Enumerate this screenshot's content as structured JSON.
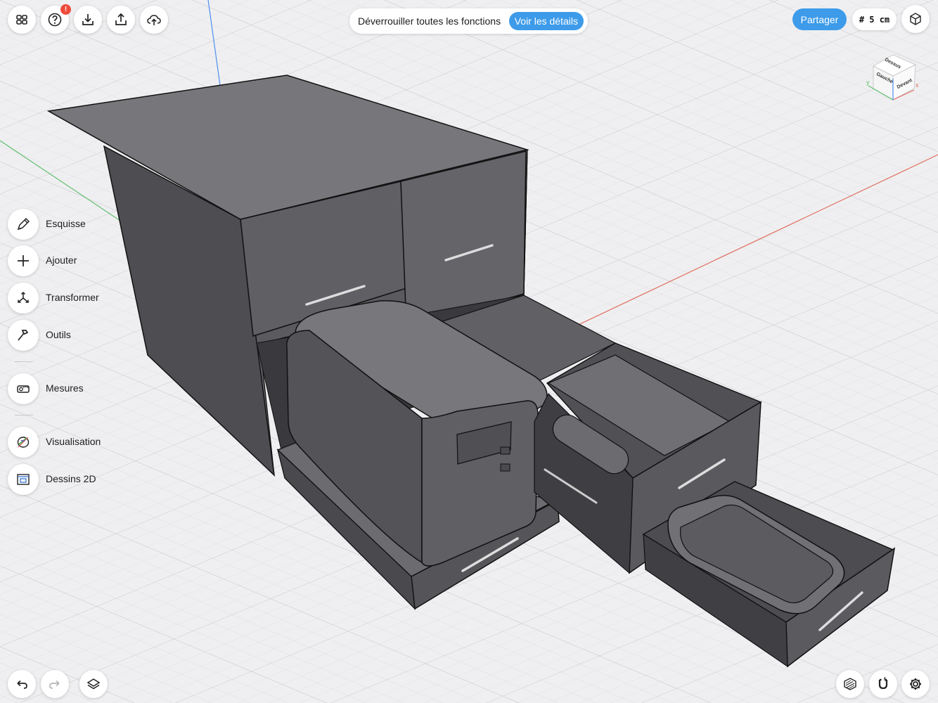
{
  "app": {
    "banner": {
      "text": "Déverrouiller toutes les fonctions",
      "button": "Voir les détails"
    },
    "badge": "!",
    "share_label": "Partager",
    "grid_label": "# 5 cm"
  },
  "toolbar_top": [
    {
      "name": "grid-view-icon"
    },
    {
      "name": "help-icon"
    },
    {
      "name": "import-icon"
    },
    {
      "name": "export-icon"
    },
    {
      "name": "cloud-upload-icon"
    }
  ],
  "tools": [
    {
      "label": "Esquisse",
      "icon": "pencil-icon"
    },
    {
      "label": "Ajouter",
      "icon": "plus-icon"
    },
    {
      "label": "Transformer",
      "icon": "transform-icon"
    },
    {
      "label": "Outils",
      "icon": "hammer-icon"
    },
    {
      "label": "Mesures",
      "icon": "tape-measure-icon"
    },
    {
      "label": "Visualisation",
      "icon": "visualization-icon"
    },
    {
      "label": "Dessins 2D",
      "icon": "drawing-2d-icon"
    }
  ],
  "view_cube": {
    "top": "Dessus",
    "left": "Gauche",
    "front": "Devant",
    "axis_x": "x",
    "axis_y": "y"
  },
  "bottom_icons": [
    "undo-icon",
    "redo-icon",
    "layers-icon",
    "material-icon",
    "snap-magnet-icon",
    "settings-icon"
  ],
  "colors": {
    "accent": "#3d9be9",
    "badge": "#ef4a3c",
    "axis_x": "#e07060",
    "axis_y": "#5fbf6f",
    "axis_z": "#4d8ef0"
  }
}
